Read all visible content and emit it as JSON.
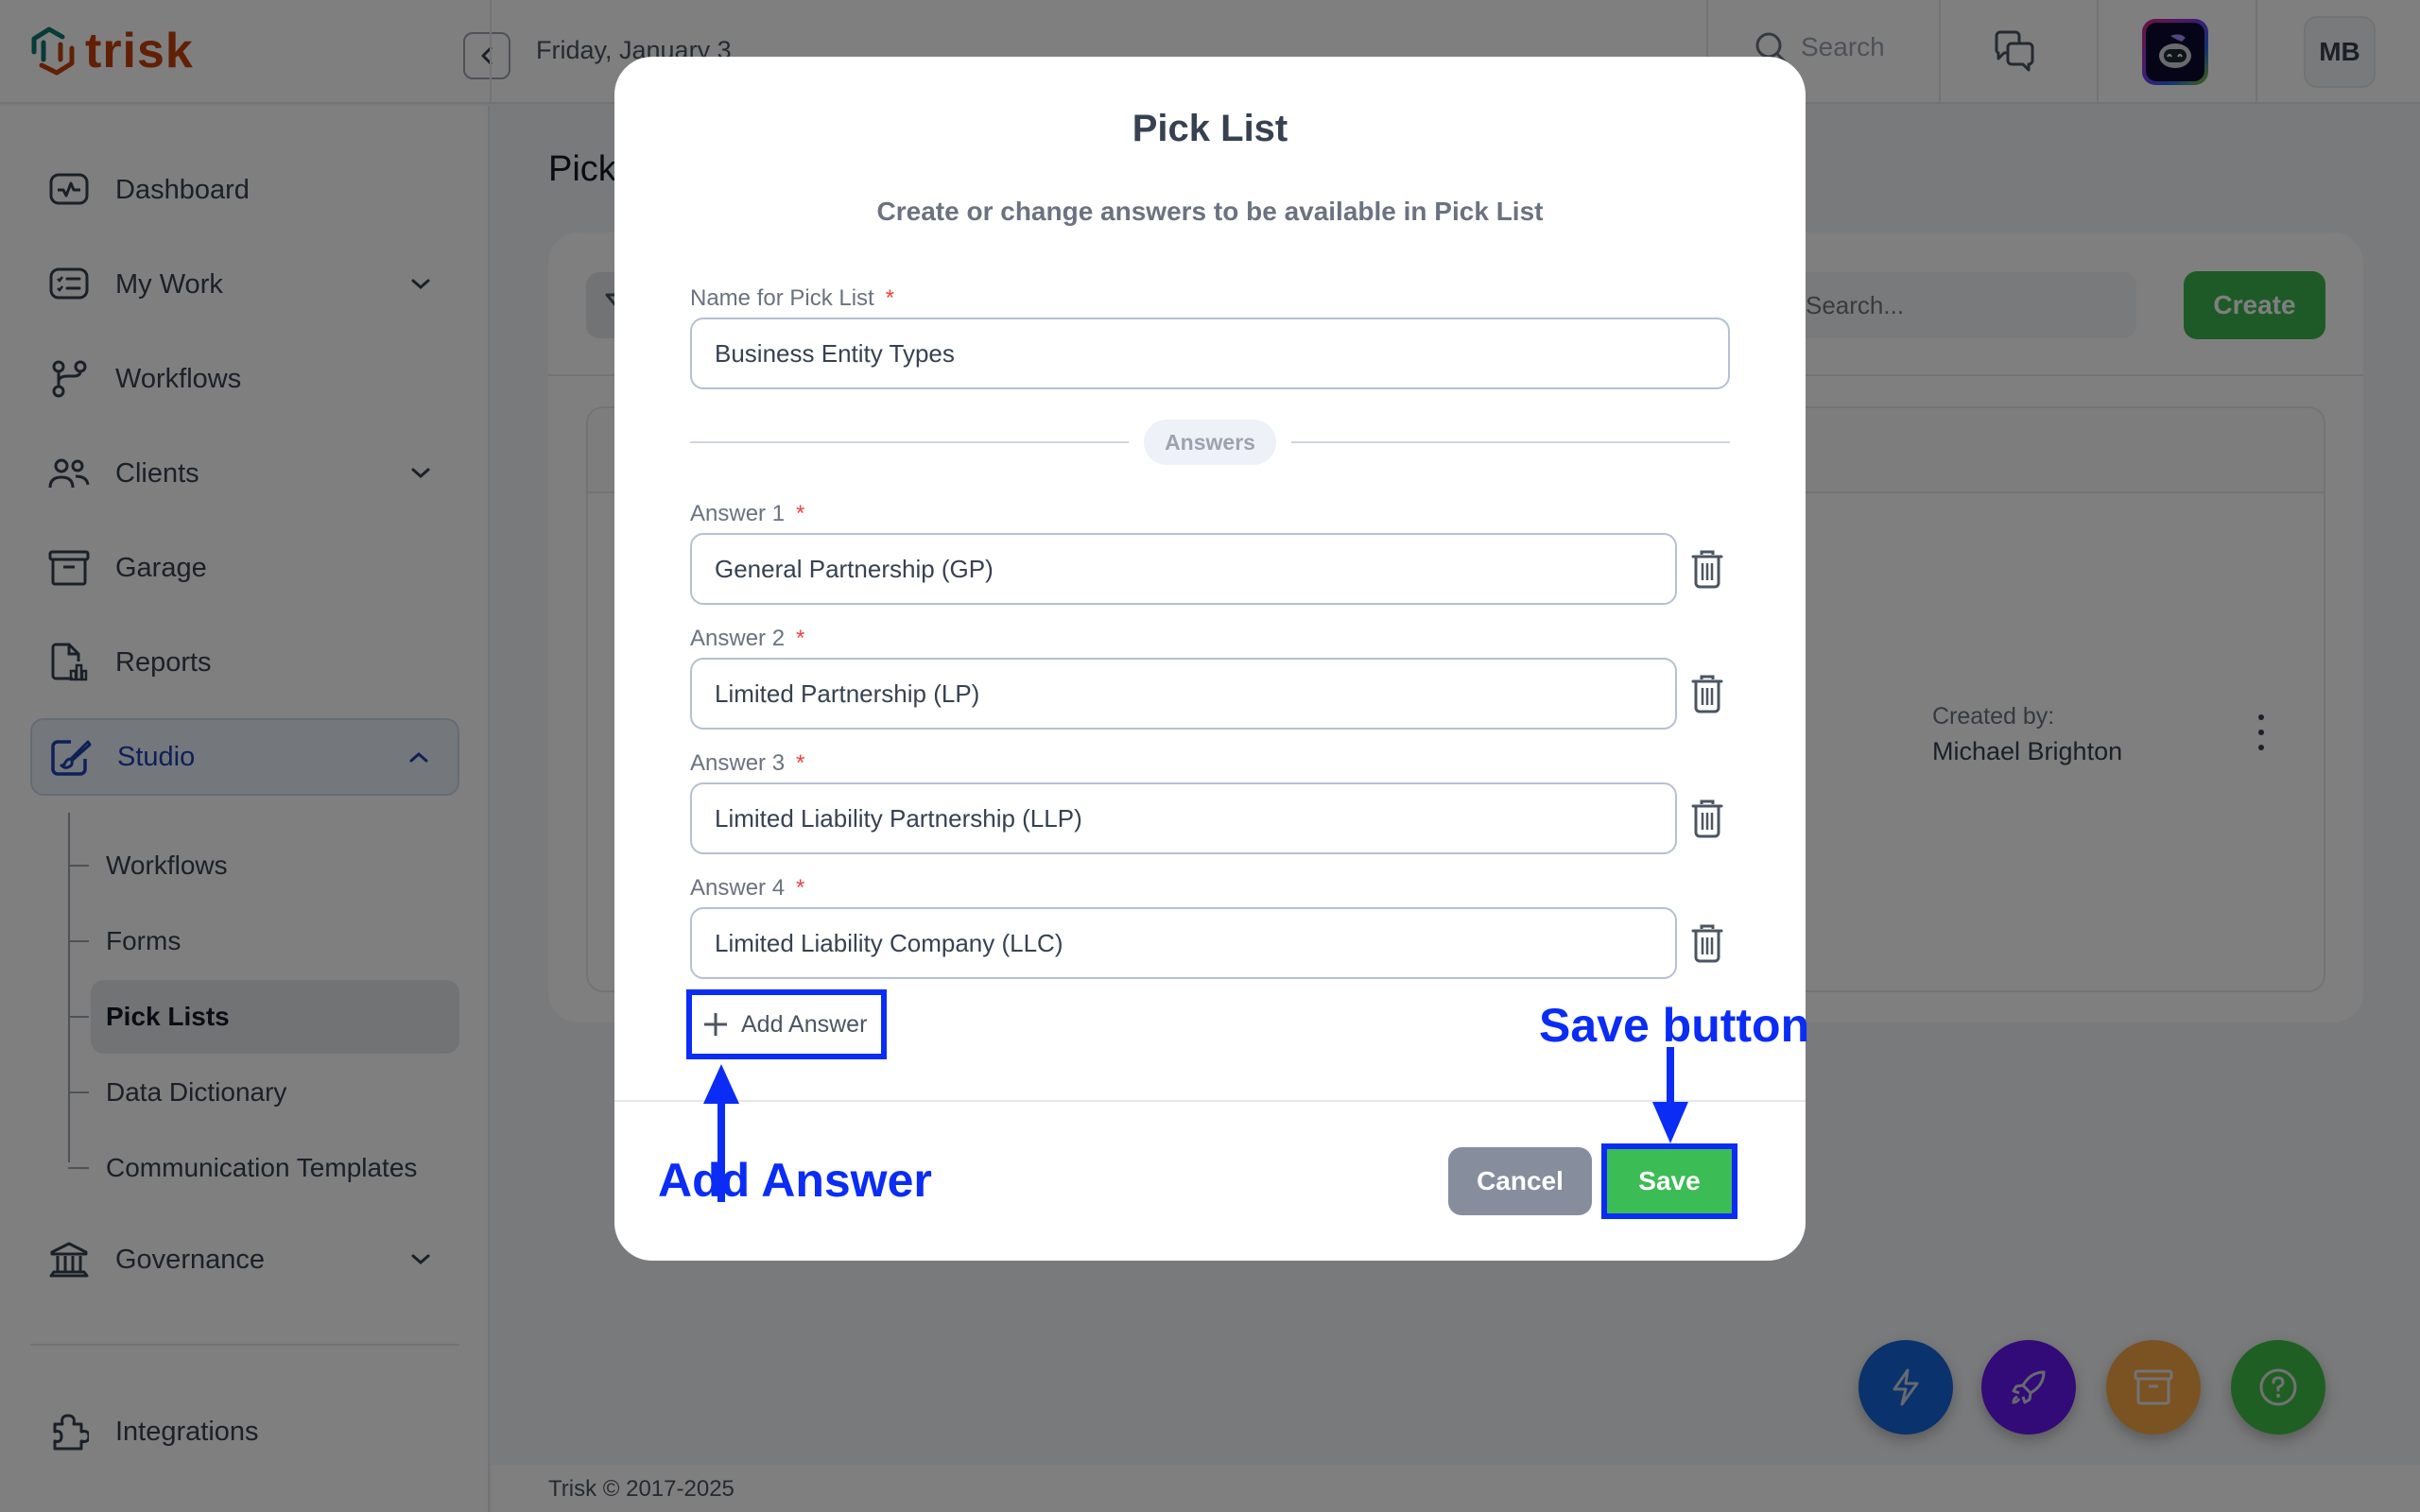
{
  "topbar": {
    "logo_text": "trisk",
    "date": "Friday, January 3",
    "search_label": "Search",
    "avatar_initials": "MB"
  },
  "sidebar": {
    "items": [
      {
        "label": "Dashboard",
        "icon": "activity-icon"
      },
      {
        "label": "My Work",
        "icon": "checklist-icon",
        "expandable": true
      },
      {
        "label": "Workflows",
        "icon": "git-branch-icon"
      },
      {
        "label": "Clients",
        "icon": "users-icon",
        "expandable": true
      },
      {
        "label": "Garage",
        "icon": "archive-icon"
      },
      {
        "label": "Reports",
        "icon": "report-icon"
      },
      {
        "label": "Studio",
        "icon": "brush-icon",
        "expandable": true,
        "active": true
      }
    ],
    "studio_subitems": [
      {
        "label": "Workflows"
      },
      {
        "label": "Forms"
      },
      {
        "label": "Pick Lists",
        "active": true
      },
      {
        "label": "Data Dictionary"
      },
      {
        "label": "Communication Templates"
      }
    ],
    "governance": {
      "label": "Governance",
      "icon": "bank-icon"
    },
    "integrations": {
      "label": "Integrations",
      "icon": "puzzle-icon"
    }
  },
  "main": {
    "page_title": "Pick Lists",
    "search_placeholder": "Search...",
    "create_label": "Create",
    "row": {
      "created_by_label": "Created by:",
      "created_by_value": "Michael Brighton"
    },
    "footer": "Trisk © 2017-2025"
  },
  "fabs": [
    {
      "name": "quick-action",
      "icon": "lightning-icon",
      "color": "#1565d8"
    },
    {
      "name": "launch",
      "icon": "rocket-icon",
      "color": "#6416f0"
    },
    {
      "name": "archive",
      "icon": "archive-icon",
      "color": "#f7a644"
    },
    {
      "name": "help",
      "icon": "help-icon",
      "color": "#3fbf48"
    }
  ],
  "modal": {
    "title": "Pick List",
    "subtitle": "Create or change answers to be available in Pick List",
    "name_label": "Name for Pick List",
    "name_value": "Business Entity Types",
    "answers_separator": "Answers",
    "answers": [
      {
        "label": "Answer 1",
        "value": "General Partnership (GP)"
      },
      {
        "label": "Answer 2",
        "value": "Limited Partnership (LP)"
      },
      {
        "label": "Answer 3",
        "value": "Limited Liability Partnership (LLP)"
      },
      {
        "label": "Answer 4",
        "value": "Limited Liability Company (LLC)"
      }
    ],
    "required_mark": "*",
    "add_answer_label": "Add Answer",
    "cancel_label": "Cancel",
    "save_label": "Save"
  },
  "annotations": {
    "add_answer": "Add Answer",
    "save_button": "Save button",
    "color": "#0a2cf5"
  }
}
